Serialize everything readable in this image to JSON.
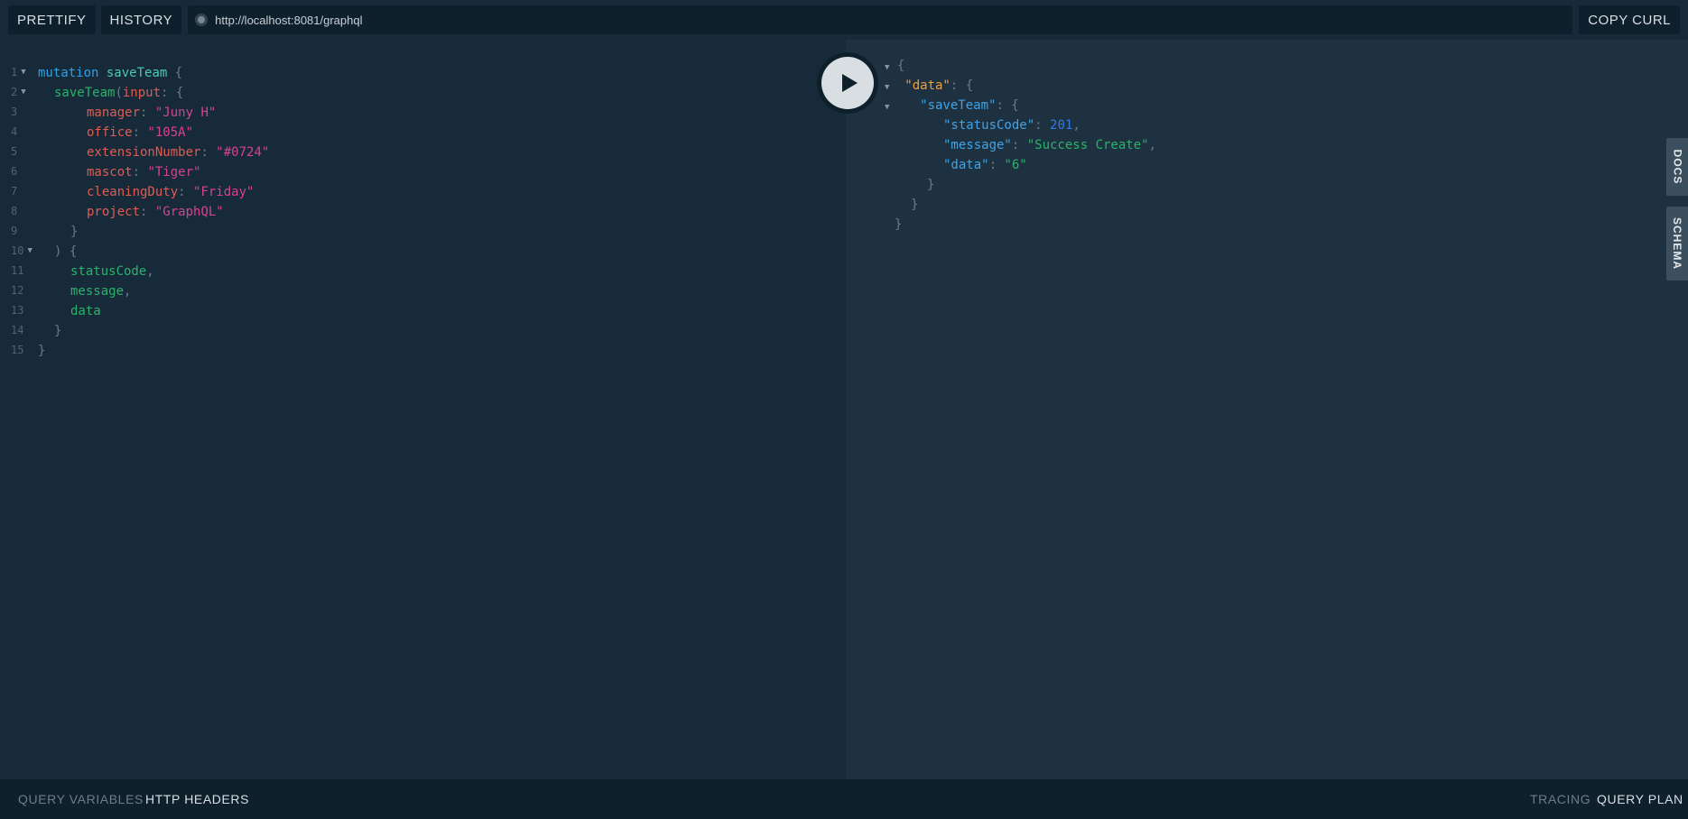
{
  "toolbar": {
    "prettify": "PRETTIFY",
    "history": "HISTORY",
    "url": "http://localhost:8081/graphql",
    "copy_curl": "COPY CURL"
  },
  "side_tabs": {
    "docs": "DOCS",
    "schema": "SCHEMA"
  },
  "bottom": {
    "query_variables": "QUERY VARIABLES",
    "http_headers": "HTTP HEADERS",
    "tracing": "TRACING",
    "query_plan": "QUERY PLAN"
  },
  "query": {
    "line_numbers": [
      "1",
      "2",
      "3",
      "4",
      "5",
      "6",
      "7",
      "8",
      "9",
      "10",
      "11",
      "12",
      "13",
      "14",
      "15"
    ],
    "mutation_keyword": "mutation",
    "operation_name": "saveTeam",
    "field_name": "saveTeam",
    "input_arg": "input",
    "args": [
      {
        "name": "manager",
        "value": "\"Juny H\""
      },
      {
        "name": "office",
        "value": "\"105A\""
      },
      {
        "name": "extensionNumber",
        "value": "\"#0724\""
      },
      {
        "name": "mascot",
        "value": "\"Tiger\""
      },
      {
        "name": "cleaningDuty",
        "value": "\"Friday\""
      },
      {
        "name": "project",
        "value": "\"GraphQL\""
      }
    ],
    "selections": [
      "statusCode",
      "message",
      "data"
    ]
  },
  "response": {
    "data_key": "\"data\"",
    "save_team_key": "\"saveTeam\"",
    "fields": [
      {
        "key": "\"statusCode\"",
        "value": "201",
        "type": "number"
      },
      {
        "key": "\"message\"",
        "value": "\"Success Create\"",
        "type": "string"
      },
      {
        "key": "\"data\"",
        "value": "\"6\"",
        "type": "string"
      }
    ]
  },
  "colors": {
    "background": "#0f202d",
    "editor_bg": "#172a3a",
    "result_bg": "#1e3140",
    "keyword": "#2ea0e6",
    "string": "#d64292",
    "field": "#2cb26b",
    "argument": "#e25b52"
  }
}
